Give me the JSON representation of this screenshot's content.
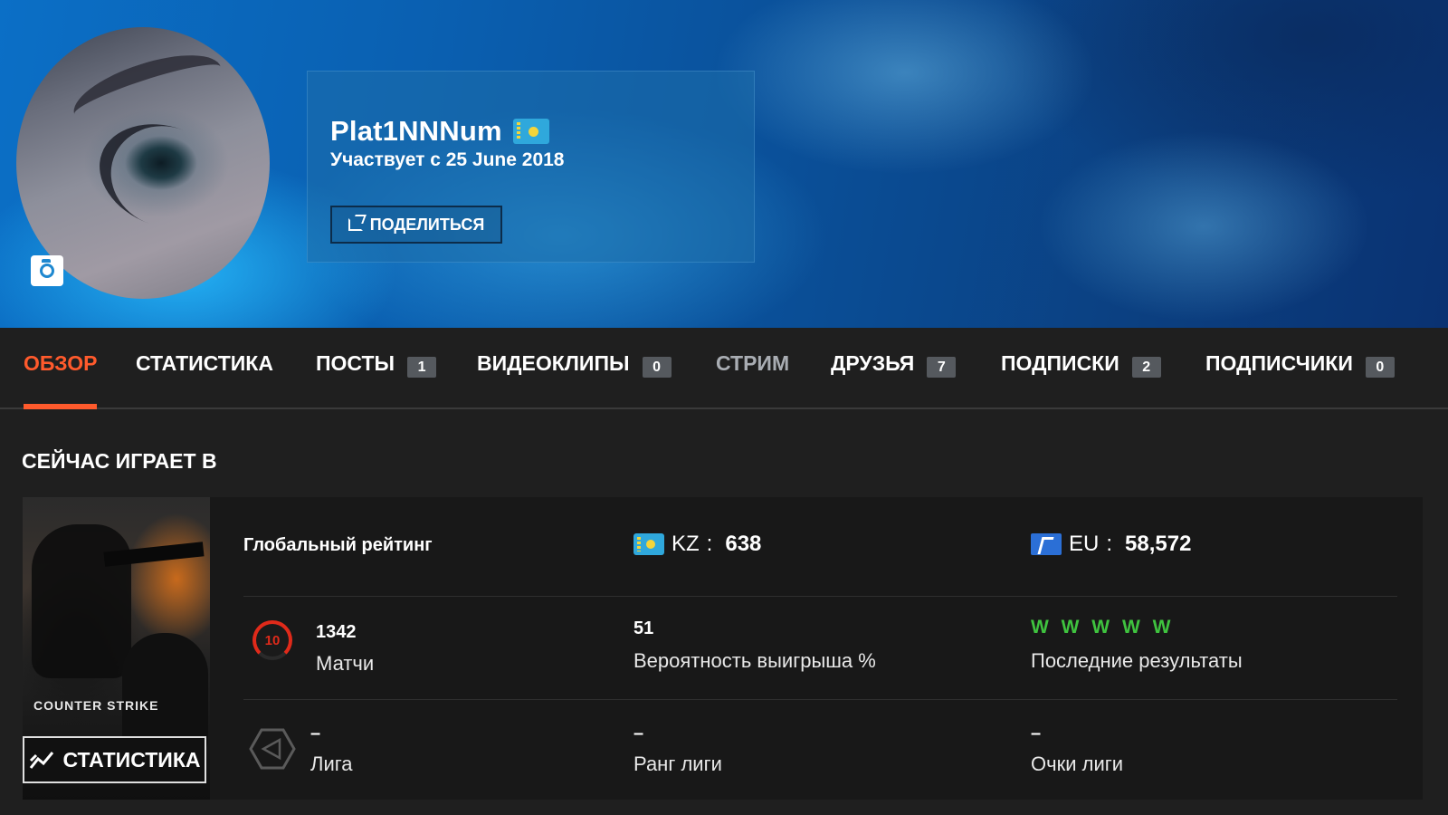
{
  "profile": {
    "username": "Plat1NNNum",
    "country_flag": "kz-flag-icon",
    "member_since": "Участвует с 25 June 2018",
    "share_label": "ПОДЕЛИТЬСЯ"
  },
  "tabs": [
    {
      "label": "ОБЗОР",
      "count": null,
      "active": true
    },
    {
      "label": "СТАТИСТИКА",
      "count": null
    },
    {
      "label": "ПОСТЫ",
      "count": "1"
    },
    {
      "label": "ВИДЕОКЛИПЫ",
      "count": "0"
    },
    {
      "label": "СТРИМ",
      "count": null
    },
    {
      "label": "ДРУЗЬЯ",
      "count": "7"
    },
    {
      "label": "ПОДПИСКИ",
      "count": "2"
    },
    {
      "label": "ПОДПИСЧИКИ",
      "count": "0"
    }
  ],
  "now_playing": {
    "title": "СЕЙЧАС ИГРАЕТ В",
    "game_logo": "COUNTER STRIKE",
    "stats_button": "СТАТИСТИКА",
    "global_rating_label": "Глобальный рейтинг",
    "kz_rank": {
      "code": "KZ",
      "value": "638"
    },
    "eu_rank": {
      "code": "EU",
      "value": "58,572"
    },
    "level": "10",
    "matches": {
      "value": "1342",
      "label": "Матчи"
    },
    "win_rate": {
      "value": "51",
      "label": "Вероятность выигрыша %"
    },
    "recent_results": {
      "value": "W W W W W",
      "label": "Последние результаты"
    },
    "league": {
      "value": "–",
      "label": "Лига"
    },
    "league_rank": {
      "value": "–",
      "label": "Ранг лиги"
    },
    "league_points": {
      "value": "–",
      "label": "Очки лиги"
    }
  },
  "colors": {
    "accent": "#ff5a2c",
    "win": "#3fc33f",
    "level_badge": "#e02a1a"
  }
}
